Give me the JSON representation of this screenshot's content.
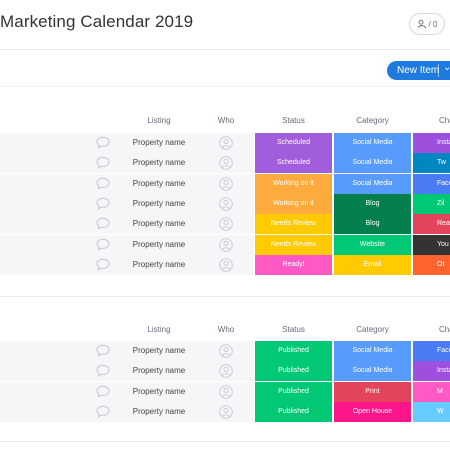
{
  "board": {
    "title": "Marketing Calendar 2019",
    "activity_count": "/ 0",
    "new_item_label": "New Item"
  },
  "columns": {
    "listing": "Listing",
    "who": "Who",
    "status": "Status",
    "category": "Category",
    "channel": "Cha"
  },
  "groups": [
    {
      "rows": [
        {
          "listing": "Property name",
          "status": "Scheduled",
          "status_color": "#a25ddc",
          "category": "Social Media",
          "category_color": "#579bfc",
          "channel": "Insta",
          "channel_color": "#9d50dd"
        },
        {
          "listing": "Property name",
          "status": "Scheduled",
          "status_color": "#a25ddc",
          "category": "Social Media",
          "category_color": "#579bfc",
          "channel": "Tw",
          "channel_color": "#0086c0"
        },
        {
          "listing": "Property name",
          "status": "Working on it",
          "status_color": "#fdab3d",
          "category": "Social Media",
          "category_color": "#579bfc",
          "channel": "Face",
          "channel_color": "#4c7cf3"
        },
        {
          "listing": "Property name",
          "status": "Working on it",
          "status_color": "#fdab3d",
          "category": "Blog",
          "category_color": "#037f4c",
          "channel": "Zil",
          "channel_color": "#00c875"
        },
        {
          "listing": "Property name",
          "status": "Needs Review",
          "status_color": "#ffcb00",
          "category": "Blog",
          "category_color": "#037f4c",
          "channel": "Realt",
          "channel_color": "#e2445c"
        },
        {
          "listing": "Property name",
          "status": "Needs Review",
          "status_color": "#ffcb00",
          "category": "Website",
          "category_color": "#00c875",
          "channel": "You",
          "channel_color": "#333333"
        },
        {
          "listing": "Property name",
          "status": "Ready!",
          "status_color": "#ff5ac4",
          "category": "Email",
          "category_color": "#ffcb00",
          "channel": "Ot",
          "channel_color": "#ff642e"
        }
      ]
    },
    {
      "rows": [
        {
          "listing": "Property name",
          "status": "Published",
          "status_color": "#00c875",
          "category": "Social Media",
          "category_color": "#579bfc",
          "channel": "Face",
          "channel_color": "#4c7cf3"
        },
        {
          "listing": "Property name",
          "status": "Published",
          "status_color": "#00c875",
          "category": "Social Media",
          "category_color": "#579bfc",
          "channel": "Insta",
          "channel_color": "#9d50dd"
        },
        {
          "listing": "Property name",
          "status": "Published",
          "status_color": "#00c875",
          "category": "Print",
          "category_color": "#e2445c",
          "channel": "M",
          "channel_color": "#ff5ac4"
        },
        {
          "listing": "Property name",
          "status": "Published",
          "status_color": "#00c875",
          "category": "Open House",
          "category_color": "#ff158a",
          "channel": "W",
          "channel_color": "#66ccff"
        }
      ]
    }
  ],
  "icons": {
    "activity": "person-search-icon",
    "chevron": "chevron-down-icon",
    "updates": "chat-bubble-icon",
    "person": "person-avatar-icon"
  }
}
